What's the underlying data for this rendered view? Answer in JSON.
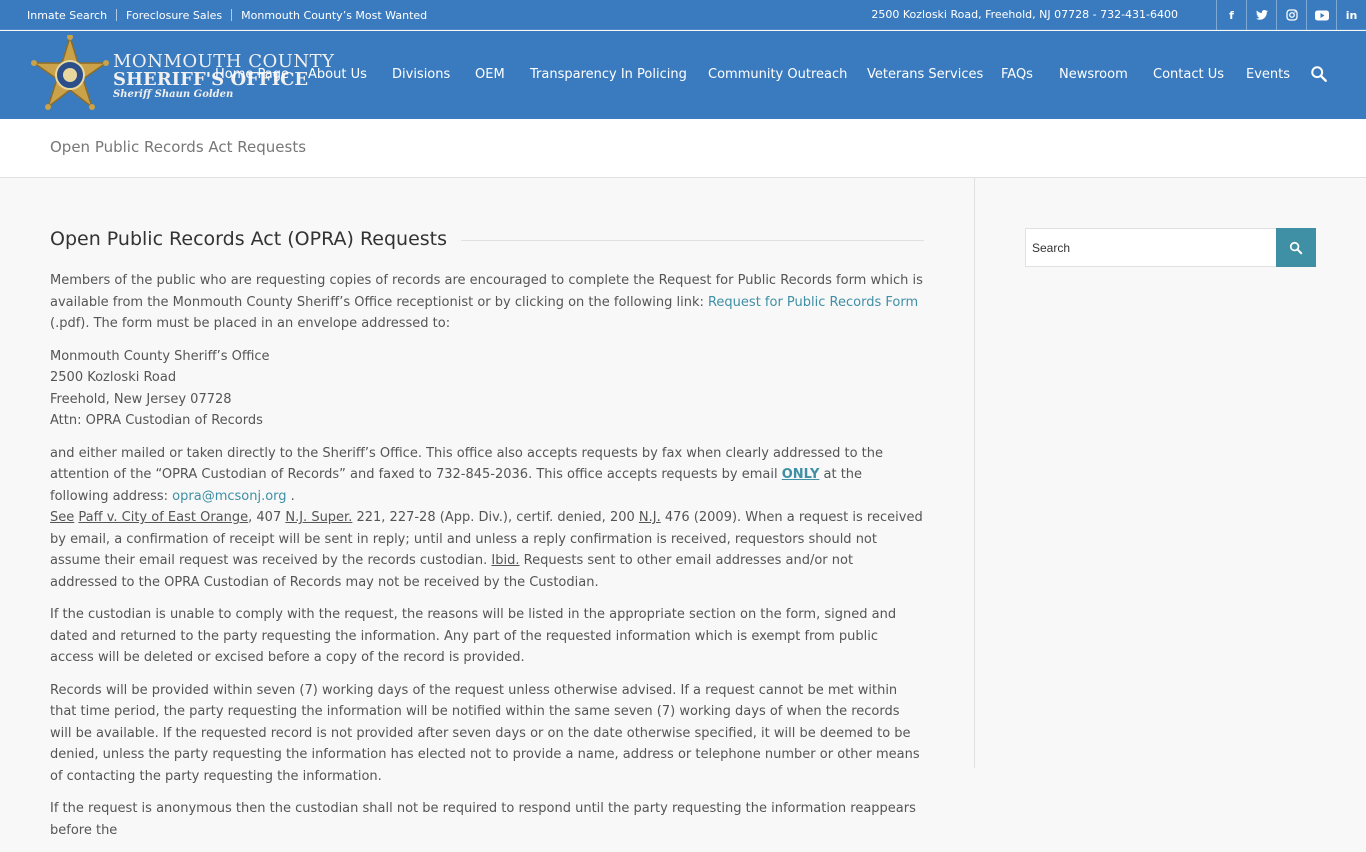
{
  "topbar": {
    "links": [
      "Inmate Search",
      "Foreclosure Sales",
      "Monmouth County’s Most Wanted"
    ],
    "address": "2500 Kozloski Road, Freehold, NJ 07728 - 732-431-6400",
    "social": [
      {
        "icon": "facebook-icon",
        "glyph": "f"
      },
      {
        "icon": "twitter-icon",
        "glyph": "t"
      },
      {
        "icon": "instagram-icon",
        "glyph": "◎"
      },
      {
        "icon": "youtube-icon",
        "glyph": "▶"
      },
      {
        "icon": "linkedin-icon",
        "glyph": "in"
      }
    ]
  },
  "logo": {
    "line1": "MONMOUTH COUNTY",
    "line2": "SHERIFF'S OFFICE",
    "line3": "Sheriff Shaun Golden"
  },
  "nav": {
    "items": [
      "Home Page",
      "About Us",
      "Divisions",
      "OEM",
      "Transparency In Policing",
      "Community Outreach",
      "Veterans Services",
      "FAQs",
      "Newsroom",
      "Contact Us",
      "Events"
    ],
    "search_icon": "search-icon"
  },
  "page": {
    "title": "Open Public Records Act Requests"
  },
  "article": {
    "heading": "Open Public Records Act (OPRA) Requests",
    "p1_a": "Members of the public who are requesting copies of records are encouraged to complete the Request for Public Records form which is available from the Monmouth County Sheriff’s Office receptionist or by clicking on the following link: ",
    "p1_link": "Request for Public Records Form",
    "p1_b": " (.pdf). The form must be placed in an envelope addressed to:",
    "address": [
      "Monmouth County Sheriff’s Office",
      "2500 Kozloski Road",
      "Freehold, New Jersey 07728",
      "Attn: OPRA Custodian of Records"
    ],
    "p2_a": "and either mailed or taken directly to the Sheriff’s Office. This office also accepts requests by fax when clearly addressed to the attention of the “OPRA Custodian of Records” and faxed to 732-845-2036. This office accepts requests by email ",
    "p2_only": "ONLY",
    "p2_b": " at the following address: ",
    "p2_email": "opra@mcsonj.org",
    "p2_c": " .",
    "p2_see": "See",
    "p2_case": "Paff v. City of East Orange",
    "p2_d": ", 407 ",
    "p2_njs": "N.J. Super.",
    "p2_e": " 221, 227-28 (App. Div.), certif. denied, 200 ",
    "p2_nj": "N.J.",
    "p2_f": " 476 (2009). When a request is received by email, a confirmation of receipt will be sent in reply; until and unless a reply confirmation is received, requestors should not assume their email request was received by the records custodian. ",
    "p2_ibid": "Ibid.",
    "p2_g": " Requests sent to other email addresses and/or not addressed to the OPRA Custodian of Records may not be received by the Custodian.",
    "p3": "If the custodian is unable to comply with the request, the reasons will be listed in the appropriate section on the form, signed and dated and returned to the party requesting the information. Any part of the requested information which is exempt from public access will be deleted or excised before a copy of the record is provided.",
    "p4": "Records will be provided within seven (7) working days of the request unless otherwise advised. If a request cannot be met within that time period, the party requesting the information will be notified within the same seven (7) working days of when the records will be available. If the requested record is not provided after seven days or on the date otherwise specified, it will be deemed to be denied, unless the party requesting the information has elected not to provide a name, address or telephone number or other means of contacting the party requesting the information.",
    "p5": "If the request is anonymous then the custodian shall not be required to respond until the party requesting the information reappears before the"
  },
  "sidebar": {
    "search_value": "Search",
    "search_icon": "search-icon"
  },
  "colors": {
    "header_blue": "#3a7bbf",
    "link_teal": "#3f8fa5"
  }
}
